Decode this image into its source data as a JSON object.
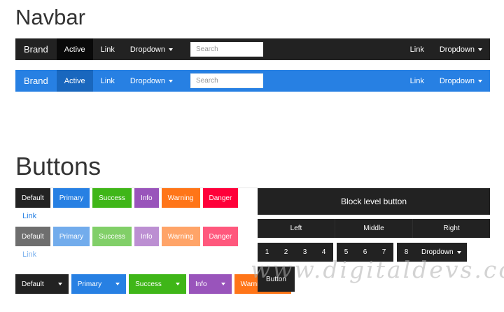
{
  "sections": {
    "navbar_title": "Navbar",
    "buttons_title": "Buttons"
  },
  "colors": {
    "dark": "#222222",
    "dark_active": "#090909",
    "primary": "#2780e3",
    "primary_active": "#1967be",
    "success": "#3fb618",
    "info": "#9954bb",
    "warning": "#ff7518",
    "danger": "#ff0039",
    "link_blue": "#2780e3"
  },
  "navbars": [
    {
      "brand": "Brand",
      "active_item": "Active",
      "link_item": "Link",
      "dropdown_item": "Dropdown",
      "search_placeholder": "Search",
      "right_link": "Link",
      "right_dropdown": "Dropdown"
    },
    {
      "brand": "Brand",
      "active_item": "Active",
      "link_item": "Link",
      "dropdown_item": "Dropdown",
      "search_placeholder": "Search",
      "right_link": "Link",
      "right_dropdown": "Dropdown"
    }
  ],
  "buttons": {
    "normal": [
      "Default",
      "Primary",
      "Success",
      "Info",
      "Warning",
      "Danger"
    ],
    "link": "Link",
    "disabled": [
      "Default",
      "Primary",
      "Success",
      "Info",
      "Warning",
      "Danger"
    ],
    "disabled_link": "Link",
    "split_dropdowns": [
      "Default",
      "Primary",
      "Success",
      "Info",
      "Warning"
    ],
    "block": "Block level button",
    "justified": [
      "Left",
      "Middle",
      "Right"
    ],
    "pager_group1": [
      "1",
      "2",
      "3",
      "4"
    ],
    "pager_group2": [
      "5",
      "6",
      "7"
    ],
    "pager_group3_number": "8",
    "pager_group3_dropdown": "Dropdown",
    "single": "Button"
  },
  "watermark": "www.digitaldevs.com"
}
